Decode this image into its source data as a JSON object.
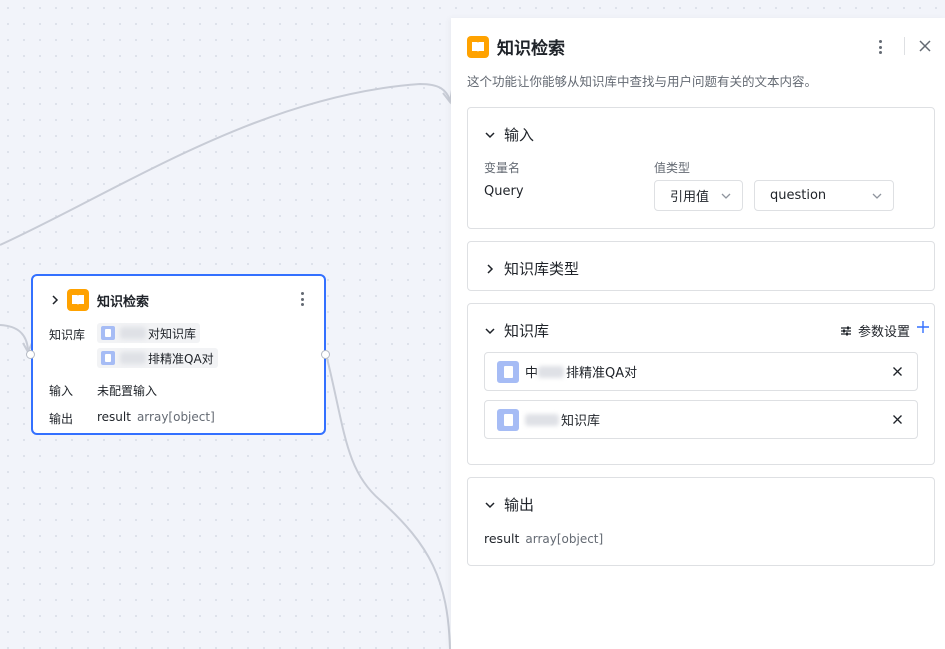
{
  "node": {
    "title": "知识检索",
    "kb_label": "知识库",
    "kb_items": [
      "对知识库",
      "排精准QA对"
    ],
    "input_label": "输入",
    "input_value": "未配置输入",
    "output_label": "输出",
    "output_name": "result",
    "output_type": "array[object]"
  },
  "panel": {
    "title": "知识检索",
    "description": "这个功能让你能够从知识库中查找与用户问题有关的文本内容。",
    "input_section": {
      "title": "输入",
      "var_name_label": "变量名",
      "value_type_label": "值类型",
      "var_name": "Query",
      "value_type": "引用值",
      "value": "question"
    },
    "kb_type_section": {
      "title": "知识库类型"
    },
    "kb_section": {
      "title": "知识库",
      "param_settings": "参数设置",
      "items": [
        {
          "prefix": "中",
          "name": "排精准QA对"
        },
        {
          "prefix": "",
          "name": "知识库"
        }
      ]
    },
    "output_section": {
      "title": "输出",
      "name": "result",
      "type": "array[object]"
    }
  },
  "colors": {
    "accent": "#3370ff",
    "icon_orange": "#ffa200",
    "kb_icon": "#a6bcf5"
  }
}
